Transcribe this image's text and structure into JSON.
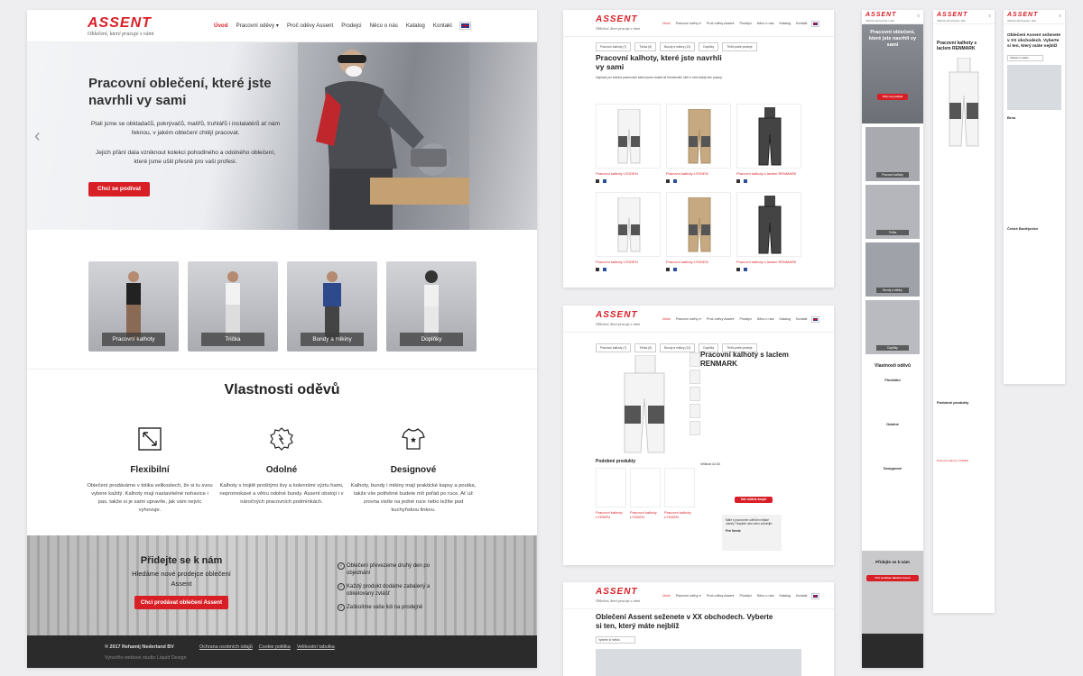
{
  "brand": {
    "logo": "ASSENT",
    "tagline": "Oblečení, které pracuje s vámi",
    "accent": "#d81f26"
  },
  "nav": {
    "items": [
      "Úvod",
      "Pracovní oděvy ▾",
      "Proč oděvy Assent",
      "Prodejci",
      "Něco o nás",
      "Katalog",
      "Kontakt"
    ],
    "language_icon": "uk-flag-icon"
  },
  "hero": {
    "title": "Pracovní oblečení, které jste navrhli vy sami",
    "p1": "Ptali jsme se obkladačů, pokrývačů, malířů, truhlářů i instalatérů ať nám řeknou, v jakém oblečení chtějí pracovat.",
    "p2": "Jejich přání dala vzniknout kolekci pohodlného a odolného oblečení, které jsme ušili přesně pro vaši profesi.",
    "cta": "Chci se podívat"
  },
  "categories": [
    "Pracovní kalhoty",
    "Trička",
    "Bundy a mikiny",
    "Doplňky"
  ],
  "properties": {
    "title": "Vlastnosti oděvů",
    "items": [
      {
        "title": "Flexibilní",
        "icon": "resize-arrows-icon",
        "text": "Oblečení prodáváme v tolika velikostech, že si tu svou vybere každý. Kalhoty mají nastavitelné nohavice i pas, takže si je sami upravíte, jak vám nejvíc vyhovuje."
      },
      {
        "title": "Odolné",
        "icon": "shield-badge-icon",
        "text": "Kalhoty s trojitě prošitými švy a kolenními výztu hami, nepromokavé a větru odolné bundy. Assent obstojí i v náročných pracovních podmínkách."
      },
      {
        "title": "Designové",
        "icon": "tshirt-icon",
        "text": "Kalhoty, bundy i mikiny mají praktické kapsy a poutka, takže vše potřebné budete mít pořád po ruce. Ať už zrovna visíte na jedné ruce nebo ležíte pod kuchyňskou linkou."
      }
    ]
  },
  "join": {
    "title": "Přidejte se k nám",
    "text": "Hledáme nové prodejce oblečení Assent",
    "cta": "Chci prodávat oblečení Assent",
    "benefits": [
      "Oblečení převezeme druhý den po objednání",
      "Každý produkt dodáme zabalený a otiketovaný zvlášť",
      "Zaškolíme vaše lidi na prodejně"
    ]
  },
  "footer": {
    "copyright": "© 2017 Rehamij Nederland BV",
    "made_by": "Vytvořilo webové studio Liquid Design",
    "links": [
      "Ochrana osobních údajů",
      "Cookie politika",
      "Velikostní tabulka"
    ]
  },
  "listing": {
    "filters": [
      "Pracovní kalhoty (7)",
      "Trička (6)",
      "Bundy a mikiny (12)",
      "Doplňky",
      "Třídit podle prodeje"
    ],
    "title": "Pracovní kalhoty, které jste navrhli vy sami",
    "intro": "Inspiraci pro kolekci pracovních kalhot jsme získali od řemeslníků, kteří s nimi každý den pracují.",
    "products": [
      "Pracovní kalhoty LYDDEN",
      "Pracovní kalhoty LYDDEN",
      "Pracovní kalhoty s laclem RENMARK",
      "Pracovní kalhoty LYDDEN",
      "Pracovní kalhoty LYDDEN",
      "Pracovní kalhoty s laclem RENMARK"
    ]
  },
  "detail": {
    "title": "Pracovní kalhoty s laclem RENMARK",
    "size_label": "Velikost 42-64",
    "similar_title": "Podobné produkty",
    "similar": [
      "Pracovní kalhoty LYDDEN",
      "Pracovní kalhoty LYDDEN",
      "Pracovní kalhoty LYDDEN"
    ],
    "cta": "Kde můžete koupit",
    "contact_name": "Petr Novák",
    "contact_note": "Máte k pracovním oděvům nějaké otázky? Napište nám nebo zavolejte."
  },
  "stores": {
    "title": "Oblečení Assent seženete v XX obchodech. Vyberte si ten, který máte nejblíž",
    "select": "Vyberte si město"
  },
  "mobile": {
    "hero_title": "Pracovní oblečení, které jste navrhli vy sami",
    "cta": "Chci se podívat",
    "props_title": "Vlastnosti oděvů",
    "join_title": "Přidejte se k nám",
    "join_cta": "Chci prodávat oblečení Assent",
    "detail_title": "Pracovní kalhoty s laclem RENMARK",
    "similar_title": "Podobné produkty",
    "stores_title": "Oblečení Assent seženete v XX obchodech. Vyberte si ten, který máte nejblíž",
    "cities": [
      "Brno",
      "České Budějovice"
    ]
  }
}
